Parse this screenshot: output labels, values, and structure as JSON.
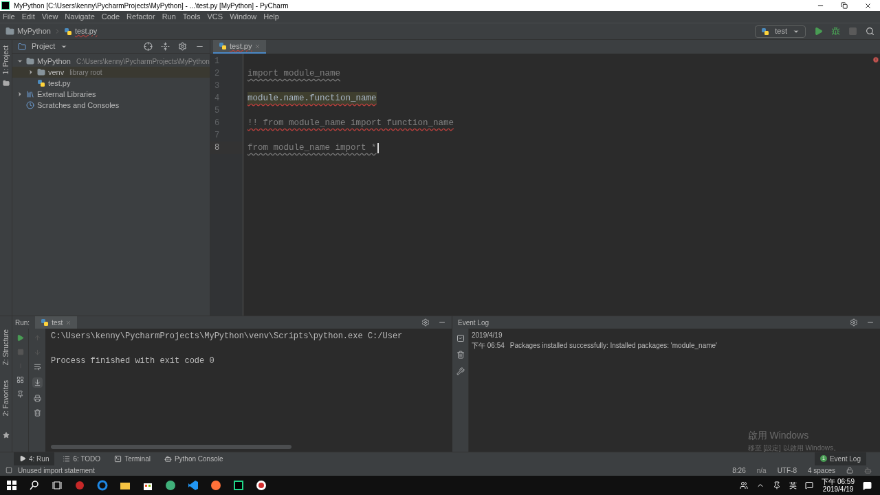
{
  "window": {
    "title": "MyPython [C:\\Users\\kenny\\PycharmProjects\\MyPython] - ...\\test.py [MyPython] - PyCharm"
  },
  "menu": [
    "File",
    "Edit",
    "View",
    "Navigate",
    "Code",
    "Refactor",
    "Run",
    "Tools",
    "VCS",
    "Window",
    "Help"
  ],
  "breadcrumb": [
    "MyPython",
    "test.py"
  ],
  "run_config": "test",
  "left_stripe": [
    "1: Project"
  ],
  "project": {
    "title": "Project",
    "tree": [
      {
        "label": "MyPython",
        "hint": "C:\\Users\\kenny\\PycharmProjects\\MyPython",
        "kind": "folder",
        "expanded": true,
        "selected": false,
        "children": [
          {
            "label": "venv",
            "hint": "library root",
            "kind": "folder",
            "expanded": false,
            "selected": true
          },
          {
            "label": "test.py",
            "kind": "file",
            "selected": false
          }
        ]
      },
      {
        "label": "External Libraries",
        "kind": "library",
        "expanded": false,
        "selected": false
      },
      {
        "label": "Scratches and Consoles",
        "kind": "scratch",
        "selected": false
      }
    ]
  },
  "editor": {
    "tab": "test.py",
    "lines": [
      {
        "number": "1",
        "current": false
      },
      {
        "number": "2",
        "text": "import module_name",
        "kind": "unused",
        "current": false
      },
      {
        "number": "3",
        "current": false
      },
      {
        "number": "4",
        "text": "module.name.function_name",
        "kind": "highlight",
        "current": false
      },
      {
        "number": "5",
        "current": false
      },
      {
        "number": "6",
        "text": "!! from module_name import function_name",
        "kind": "error",
        "current": false
      },
      {
        "number": "7",
        "current": false
      },
      {
        "number": "8",
        "text": "from module_name import *",
        "kind": "unused",
        "current": true
      }
    ]
  },
  "bottom_stripe": [
    "Z: Structure",
    "2: Favorites"
  ],
  "run_panel": {
    "label": "Run:",
    "tab": "test",
    "output": [
      "C:\\Users\\kenny\\PycharmProjects\\MyPython\\venv\\Scripts\\python.exe C:/User",
      "Process finished with exit code 0"
    ]
  },
  "event_log": {
    "title": "Event Log",
    "date": "2019/4/19",
    "time": "下午 06:54",
    "message": "Packages installed successfully: Installed packages: 'module_name'"
  },
  "activation": {
    "title": "啟用 Windows",
    "subtitle": "移至 [設定] 以啟用 Windows。"
  },
  "tool_buttons": [
    {
      "label": "4: Run",
      "kind": "run",
      "selected": true
    },
    {
      "label": "6: TODO",
      "kind": "todo",
      "selected": false
    },
    {
      "label": "Terminal",
      "kind": "terminal",
      "selected": false
    },
    {
      "label": "Python Console",
      "kind": "console",
      "selected": false
    }
  ],
  "event_log_button": {
    "label": "Event Log",
    "badge": "1"
  },
  "status": {
    "message": "Unused import statement",
    "position": "8:26",
    "na": "n/a",
    "encoding": "UTF-8",
    "indent": "4 spaces"
  },
  "taskbar": {
    "ime": "英",
    "time": "下午 06:59",
    "date": "2019/4/19"
  }
}
